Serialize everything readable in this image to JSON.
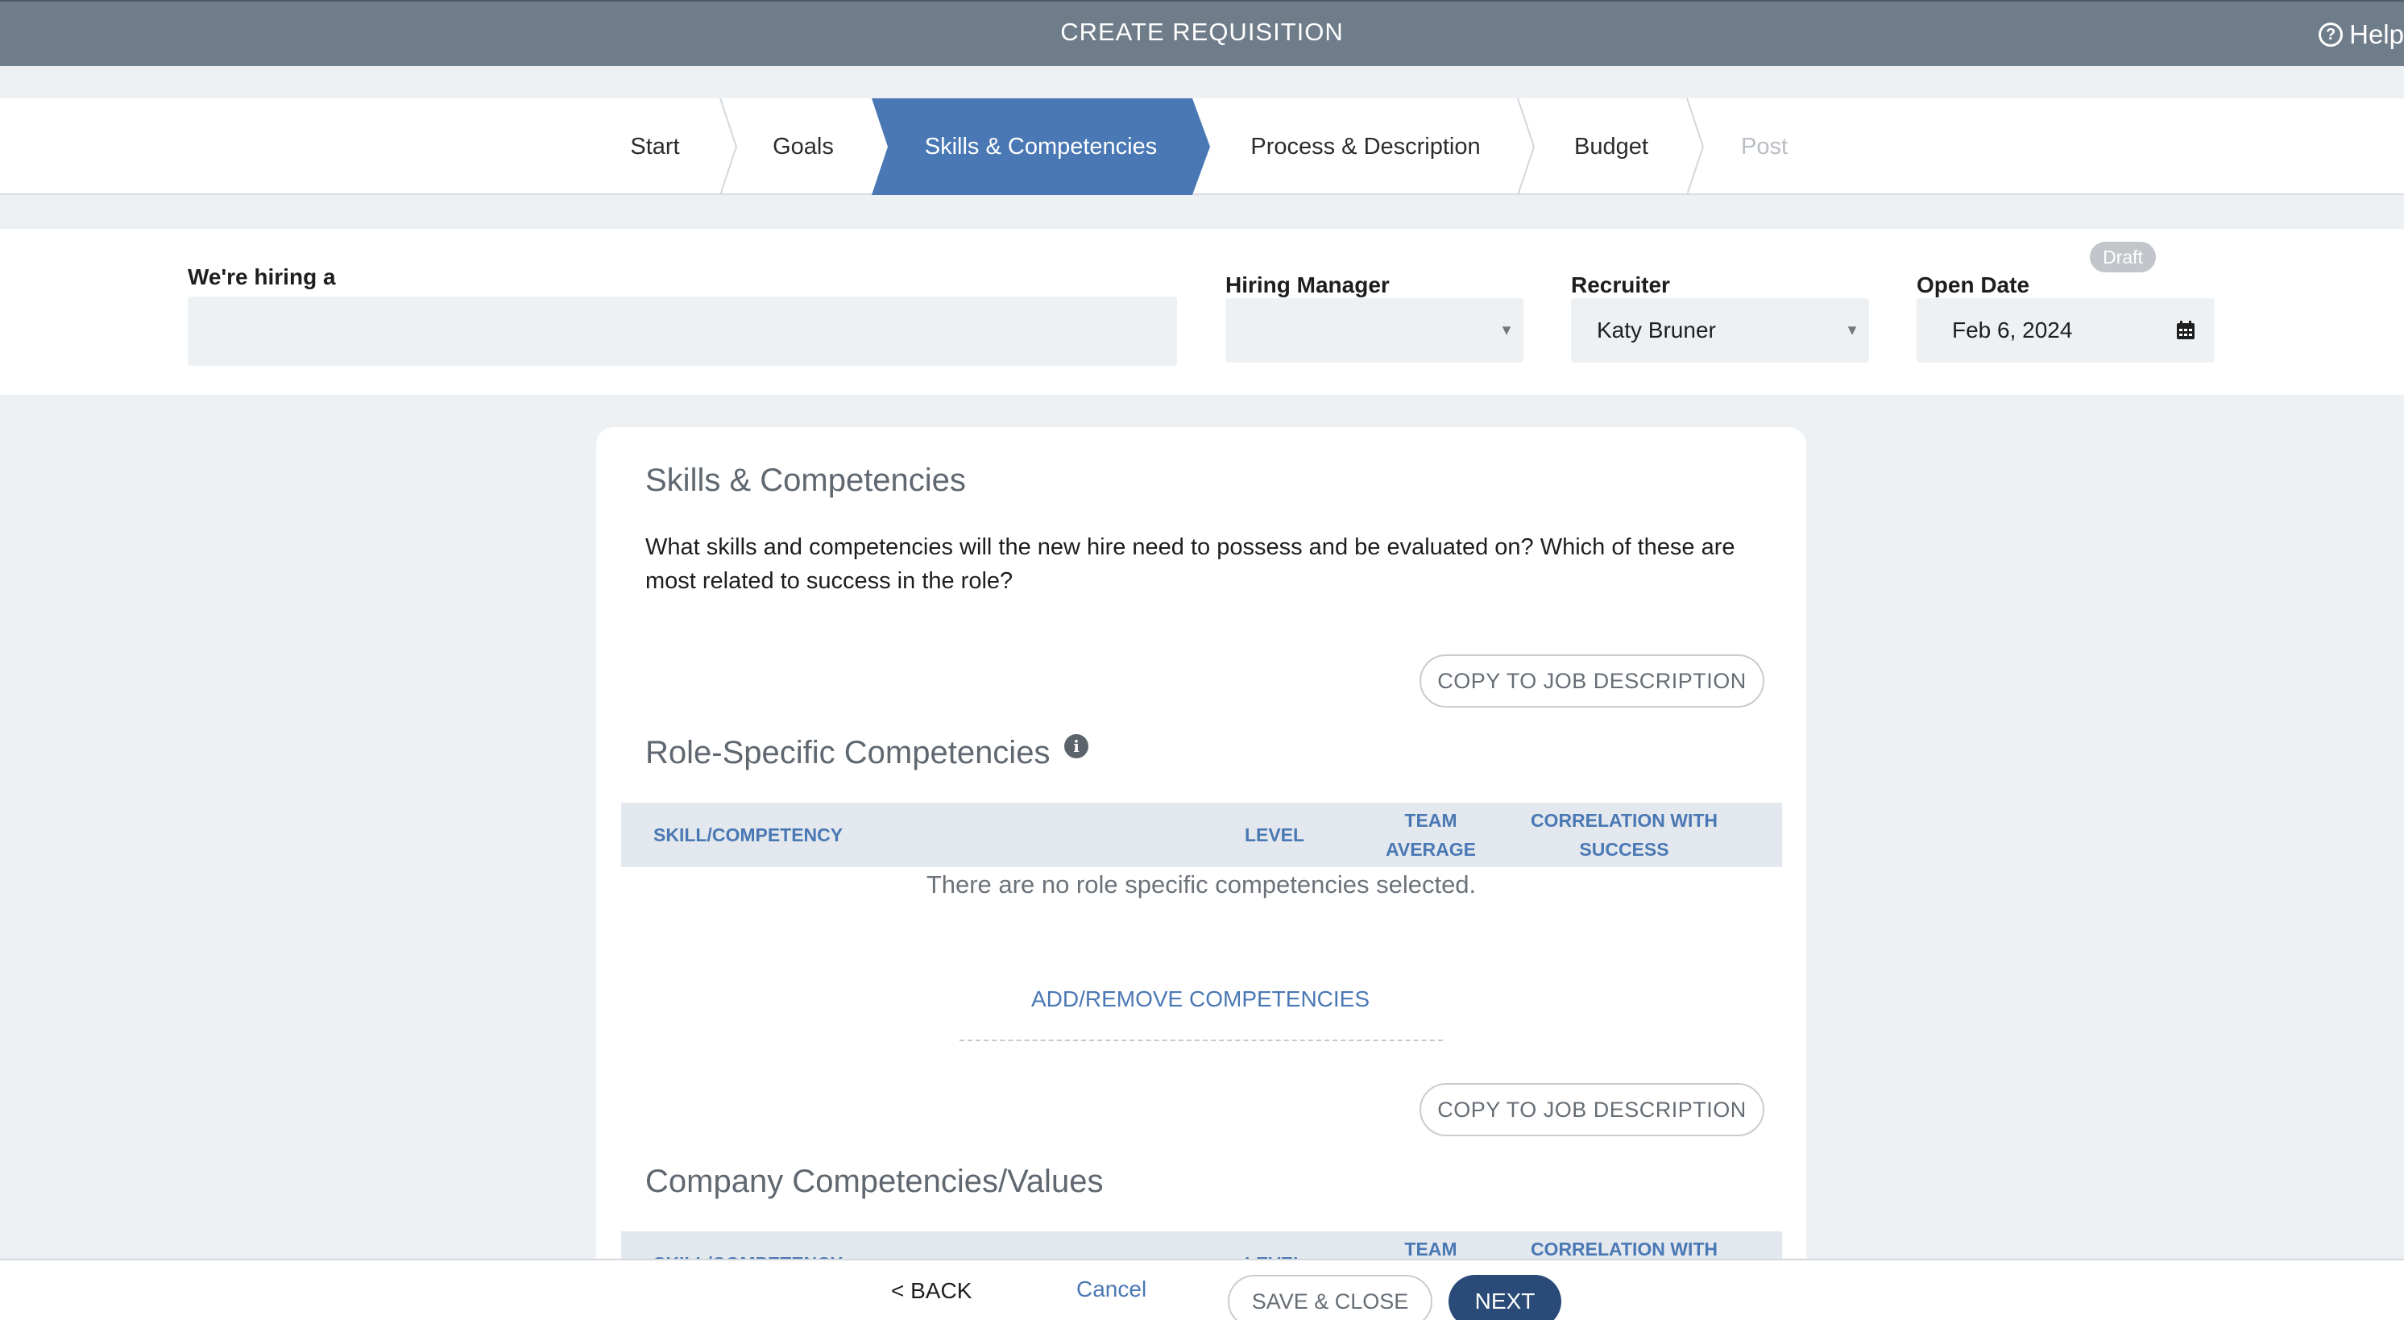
{
  "header": {
    "title": "CREATE REQUISITION",
    "help_label": "Help"
  },
  "stepper": {
    "steps": [
      {
        "label": "Start"
      },
      {
        "label": "Goals"
      },
      {
        "label": "Skills & Competencies",
        "active": true
      },
      {
        "label": "Process & Description"
      },
      {
        "label": "Budget"
      },
      {
        "label": "Post",
        "disabled": true
      }
    ],
    "active_color": "#4a78b4"
  },
  "hiring": {
    "hiring_label": "We're hiring a",
    "hiring_value": "",
    "manager_label": "Hiring Manager",
    "manager_value": "",
    "recruiter_label": "Recruiter",
    "recruiter_value": "Katy Bruner",
    "open_date_label": "Open Date",
    "open_date_value": "Feb 6, 2024",
    "status_badge": "Draft"
  },
  "card": {
    "title": "Skills & Competencies",
    "description": "What skills and competencies will the new hire need to possess and be evaluated on? Which of these are most related to success in the role?",
    "copy_button_1": "COPY TO JOB DESCRIPTION",
    "role_section_title": "Role-Specific Competencies",
    "columns": {
      "skill": "SKILL/COMPETENCY",
      "level": "LEVEL",
      "team_average_1": "TEAM",
      "team_average_2": "AVERAGE",
      "correlation_1": "CORRELATION WITH",
      "correlation_2": "SUCCESS"
    },
    "empty_message": "There are no role specific competencies selected.",
    "add_remove_link": "ADD/REMOVE COMPETENCIES",
    "copy_button_2": "COPY TO JOB DESCRIPTION",
    "company_section_title": "Company Competencies/Values"
  },
  "footer": {
    "back_label": "< BACK",
    "cancel_label": "Cancel",
    "save_close_label": "SAVE & CLOSE",
    "next_label": "NEXT"
  },
  "colors": {
    "header_bg": "#6f7d8a",
    "accent": "#4a78b4",
    "primary_button": "#2a4a78"
  }
}
